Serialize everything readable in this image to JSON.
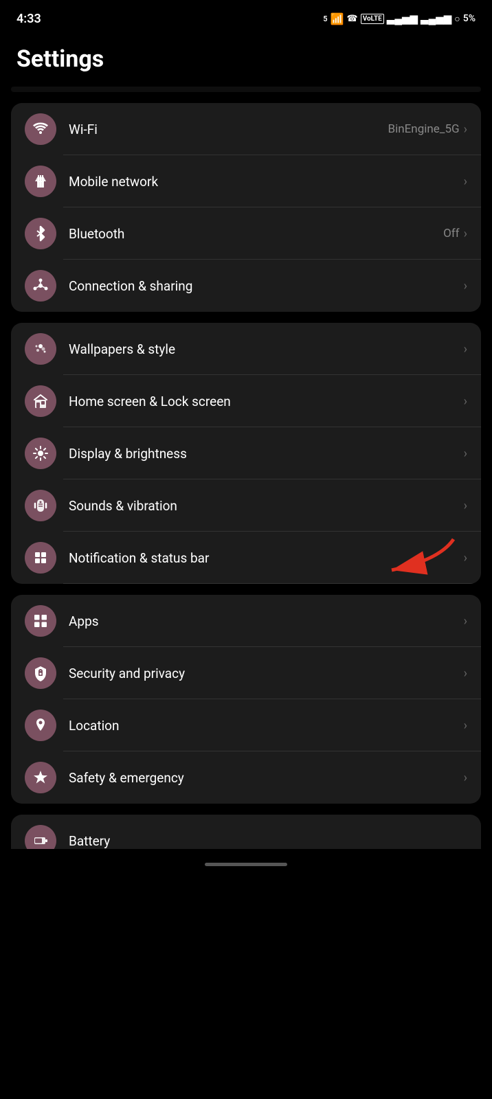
{
  "statusBar": {
    "time": "4:33",
    "batteryPercent": "5%",
    "icons": "5G WiFi Call"
  },
  "pageTitle": "Settings",
  "groups": [
    {
      "id": "connectivity",
      "items": [
        {
          "id": "wifi",
          "label": "Wi-Fi",
          "value": "BinEngine_5G",
          "icon": "wifi",
          "iconUnicode": "📶"
        },
        {
          "id": "mobile-network",
          "label": "Mobile network",
          "value": "",
          "icon": "mobile",
          "iconUnicode": "↕"
        },
        {
          "id": "bluetooth",
          "label": "Bluetooth",
          "value": "Off",
          "icon": "bluetooth",
          "iconUnicode": "✱"
        },
        {
          "id": "connection-sharing",
          "label": "Connection & sharing",
          "value": "",
          "icon": "share",
          "iconUnicode": "⟳"
        }
      ]
    },
    {
      "id": "display",
      "items": [
        {
          "id": "wallpapers",
          "label": "Wallpapers & style",
          "value": "",
          "icon": "palette",
          "iconUnicode": "🎨"
        },
        {
          "id": "home-lock",
          "label": "Home screen & Lock screen",
          "value": "",
          "icon": "home",
          "iconUnicode": "🖼"
        },
        {
          "id": "display-brightness",
          "label": "Display & brightness",
          "value": "",
          "icon": "sun",
          "iconUnicode": "☀"
        },
        {
          "id": "sounds-vibration",
          "label": "Sounds & vibration",
          "value": "",
          "icon": "bell",
          "iconUnicode": "🔔",
          "hasArrow": true
        },
        {
          "id": "notification-status",
          "label": "Notification & status bar",
          "value": "",
          "icon": "notification",
          "iconUnicode": "🔲"
        }
      ]
    },
    {
      "id": "privacy",
      "items": [
        {
          "id": "apps",
          "label": "Apps",
          "value": "",
          "icon": "apps",
          "iconUnicode": "⊞"
        },
        {
          "id": "security-privacy",
          "label": "Security and privacy",
          "value": "",
          "icon": "security",
          "iconUnicode": "🔒"
        },
        {
          "id": "location",
          "label": "Location",
          "value": "",
          "icon": "location",
          "iconUnicode": "📍"
        },
        {
          "id": "safety-emergency",
          "label": "Safety & emergency",
          "value": "",
          "icon": "emergency",
          "iconUnicode": "✱"
        }
      ]
    }
  ],
  "partialItem": {
    "label": "Battery",
    "icon": "battery",
    "iconUnicode": "🔋"
  }
}
